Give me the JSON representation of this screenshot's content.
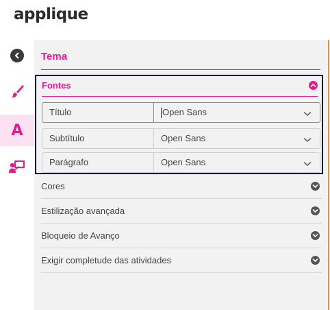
{
  "app": {
    "logo": "applique"
  },
  "sidebar": {
    "icons": [
      "back-icon",
      "paint-brush-icon",
      "font-icon",
      "presentation-user-icon"
    ],
    "active_letter": "A"
  },
  "panel": {
    "title": "Tema",
    "fontes": {
      "title": "Fontes",
      "rows": [
        {
          "label": "Título",
          "value": "Open Sans"
        },
        {
          "label": "Subtítulo",
          "value": "Open Sans"
        },
        {
          "label": "Parágrafo",
          "value": "Open Sans"
        }
      ]
    },
    "accordions": [
      {
        "label": "Cores"
      },
      {
        "label": "Estilização avançada"
      },
      {
        "label": "Bloqueio de Avanço"
      },
      {
        "label": "Exigir completude das atividades"
      }
    ]
  },
  "colors": {
    "accent": "#e6198f",
    "accent_light": "#fde1f3",
    "panel_bg": "#f2f2f2",
    "edge": "#f58a3b"
  }
}
